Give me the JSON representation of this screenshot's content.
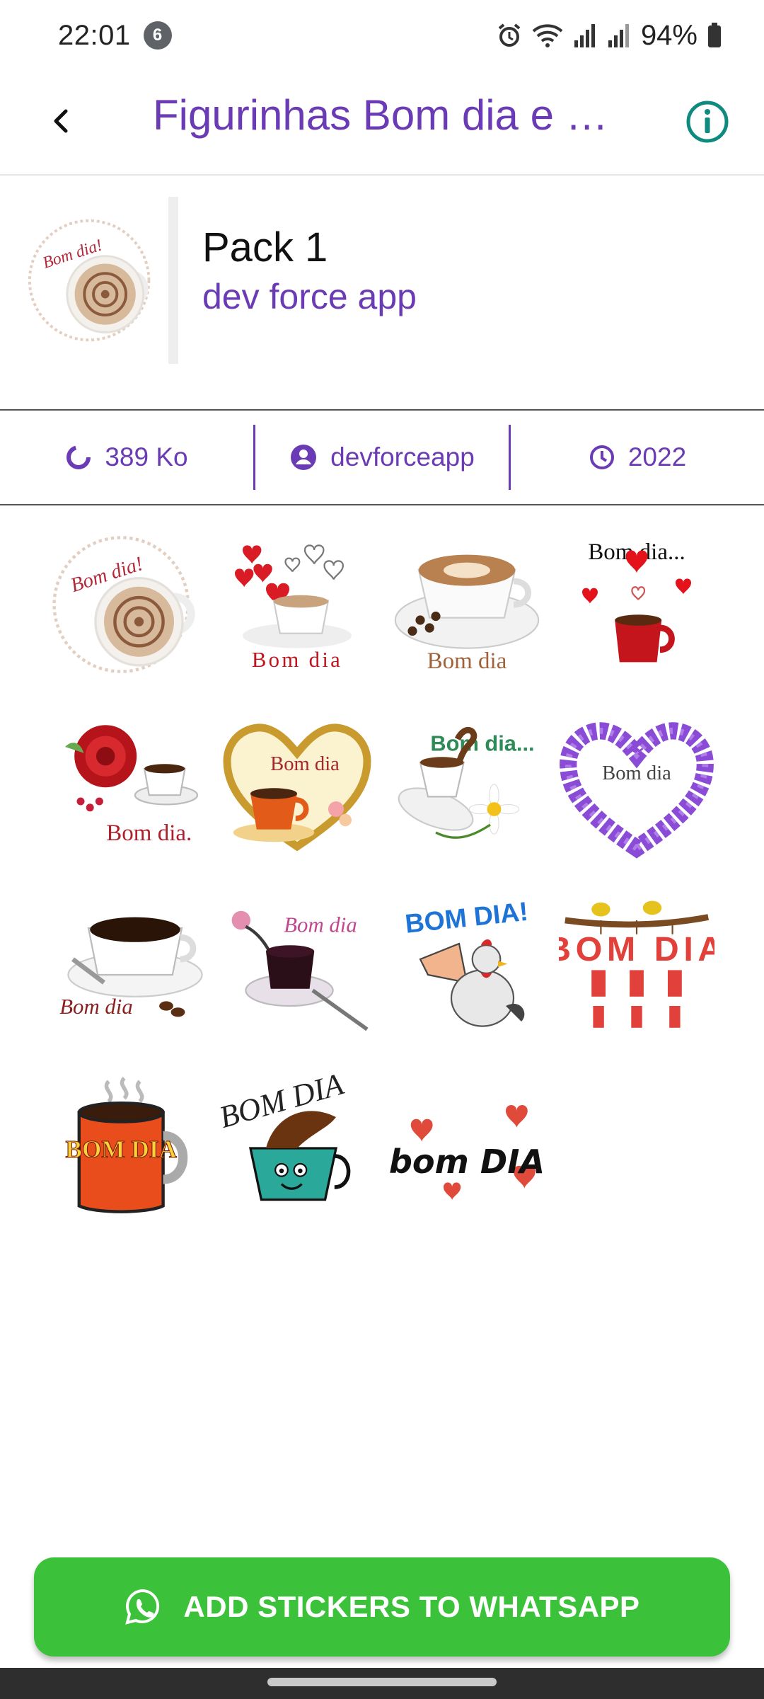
{
  "status_bar": {
    "time": "22:01",
    "notification_count": "6",
    "battery": "94%",
    "icons": [
      "alarm-icon",
      "wifi-icon",
      "signal-icon",
      "signal-icon",
      "battery-icon"
    ]
  },
  "app_bar": {
    "title": "Figurinhas Bom dia e Bo...",
    "back_icon": "back-arrow-icon",
    "info_icon": "info-icon"
  },
  "pack": {
    "name": "Pack 1",
    "publisher": "dev force app"
  },
  "info": {
    "size": "389 Ko",
    "author": "devforceapp",
    "year": "2022"
  },
  "stickers": {
    "texts": [
      "Bom dia!",
      "Bom dia",
      "Bom dia",
      "Bom dia...",
      "Bom dia.",
      "Bom dia",
      "Bom dia...",
      "Bom dia",
      "Bom dia",
      "Bom dia",
      "BOM DIA!",
      "BOM DIA",
      "BOM DIA",
      "BOM DIA",
      "bom DIA"
    ]
  },
  "add_button": {
    "label": "ADD STICKERS TO WHATSAPP",
    "icon": "whatsapp-icon"
  },
  "colors": {
    "accent": "#6a3bb5",
    "button": "#3cc13b"
  }
}
